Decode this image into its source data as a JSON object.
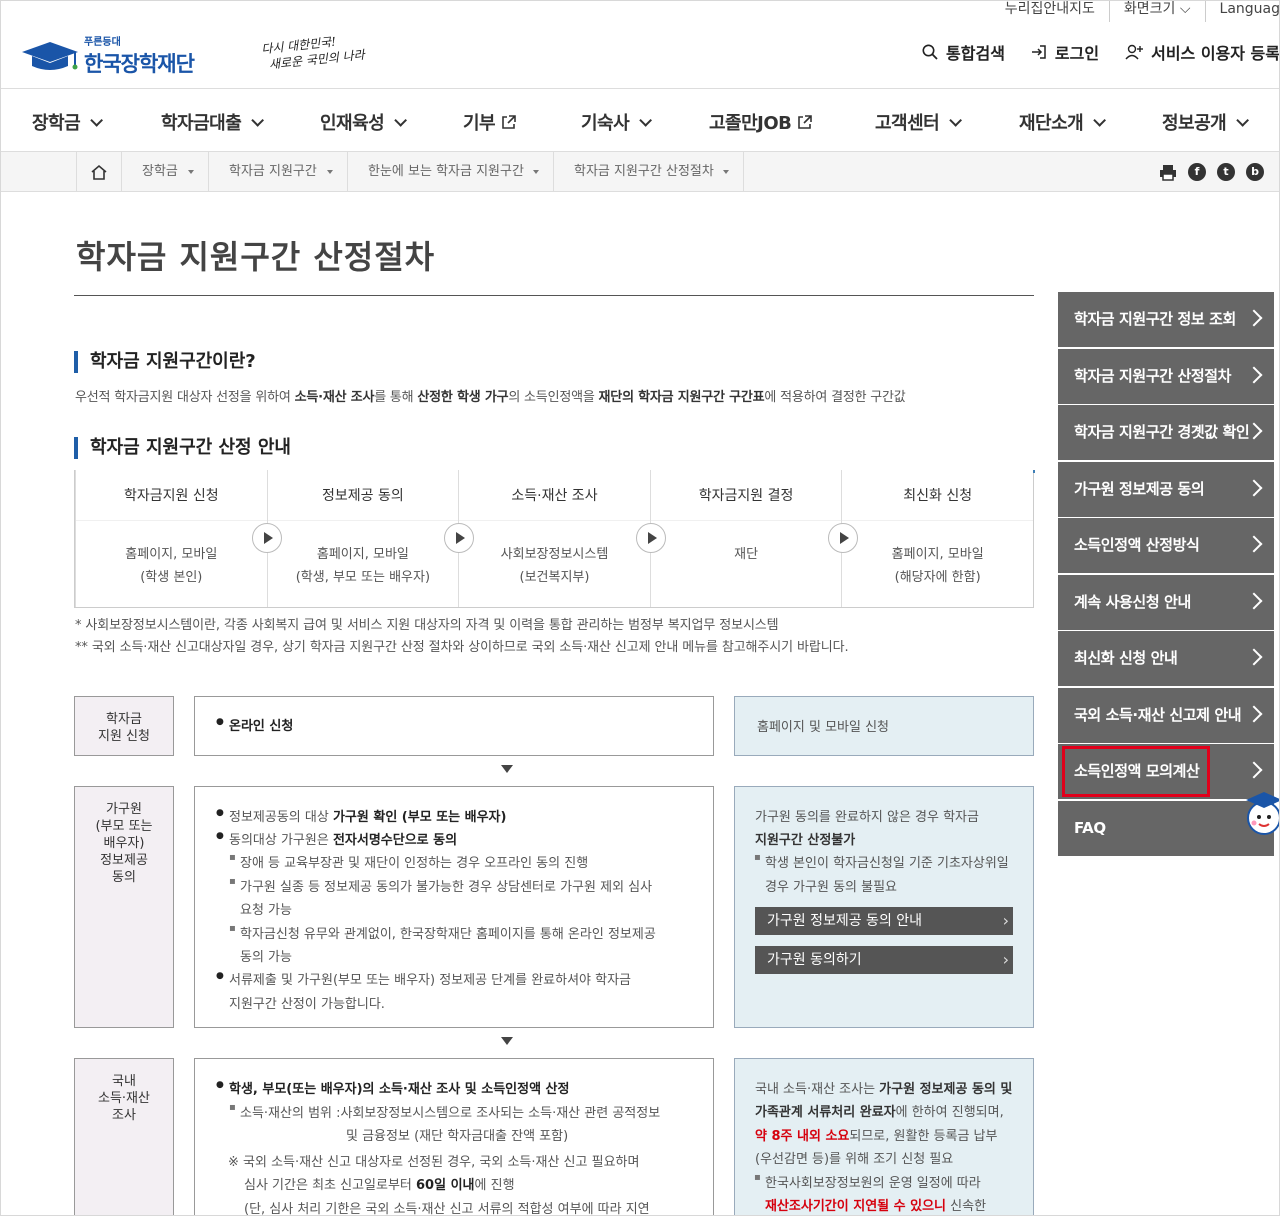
{
  "util": {
    "map": "누리집안내지도",
    "zoom": "화면크기",
    "lang": "Languag"
  },
  "logo": {
    "small": "푸른등대",
    "name": "한국장학재단"
  },
  "slogan": {
    "line1": "다시 대한민국!",
    "line2": "새로운 국민의 나라"
  },
  "header": {
    "search": "통합검색",
    "login": "로그인",
    "register": "서비스 이용자 등록"
  },
  "gnb": [
    "장학금",
    "학자금대출",
    "인재육성",
    "기부",
    "기숙사",
    "고졸만JOB",
    "고객센터",
    "재단소개",
    "정보공개"
  ],
  "breadcrumb": [
    "장학금",
    "학자금 지원구간",
    "한눈에 보는 학자금 지원구간",
    "학자금 지원구간 산정절차"
  ],
  "share": {
    "fb": "f",
    "tw": "t",
    "blog": "b"
  },
  "page_title": "학자금 지원구간 산정절차",
  "sec1": {
    "title": "학자금 지원구간이란?",
    "desc_parts": [
      "우선적 학자금지원 대상자 선정을 위하여 ",
      "소득·재산 조사",
      "를 통해 ",
      "산정한 학생 가구",
      "의 소득인정액을 ",
      "재단의 학자금 지원구간 구간표",
      "에 적용하여 결정한 구간값"
    ]
  },
  "sec2": {
    "title": "학자금 지원구간 산정 안내"
  },
  "steps": [
    {
      "title": "학자금지원 신청",
      "l1": "홈페이지, 모바일",
      "l2": "(학생 본인)"
    },
    {
      "title": "정보제공 동의",
      "l1": "홈페이지, 모바일",
      "l2": "(학생, 부모 또는 배우자)"
    },
    {
      "title": "소득·재산 조사",
      "l1": "사회보장정보시스템",
      "l2": "(보건복지부)"
    },
    {
      "title": "학자금지원 결정",
      "l1": "재단",
      "l2": ""
    },
    {
      "title": "최신화 신청",
      "l1": "홈페이지, 모바일",
      "l2": "(해당자에 한함)"
    }
  ],
  "notes": {
    "n1": "* 사회보장정보시스템이란, 각종 사회복지 급여 및 서비스 지원 대상자의 자격 및 이력을 통합 관리하는 범정부 복지업무 정보시스템",
    "n2": "** 국외 소득·재산 신고대상자일 경우, 상기 학자금 지원구간 산정 절차와 상이하므로 국외 소득·재산 신고제 안내 메뉴를 참고해주시기 바랍니다."
  },
  "row1": {
    "l1": "학자금",
    "l2": "지원 신청",
    "main": "온라인 신청",
    "right": "홈페이지 및 모바일 신청"
  },
  "row2": {
    "label": [
      "가구원",
      "(부모 또는",
      "배우자)",
      "정보제공",
      "동의"
    ],
    "a1": "정보제공동의 대상 ",
    "a1b": "가구원 확인 (부모 또는 배우자)",
    "a2": "동의대상 가구원은 ",
    "a2b": "전자서명수단으로 동의",
    "s1": "장애 등 교육부장관 및 재단이 인정하는 경우 오프라인 동의 진행",
    "s2a": "가구원 실종 등 정보제공 동의가 불가능한 경우 상담센터로 가구원 제외 심사",
    "s2b": "요청 가능",
    "s3a": "학자금신청 유무와 관계없이, 한국장학재단 홈페이지를 통해 온라인 정보제공",
    "s3b": "동의 가능",
    "a3a": "서류제출 및 가구원(부모 또는 배우자) 정보제공 단계를 완료하셔야 학자금",
    "a3b": "지원구간 산정이 가능합니다.",
    "r1": "가구원 동의를 완료하지 않은 경우 학자금",
    "r2": "지원구간 산정불가",
    "r3": "학생 본인이 학자금신청일 기준 기초자상위일",
    "r4": "경우 가구원 동의 불필요",
    "btn1": "가구원 정보제공 동의 안내",
    "btn2": "가구원 동의하기"
  },
  "row3": {
    "label": [
      "국내",
      "소득·재산",
      "조사"
    ],
    "a1": "학생, 부모(또는 배우자)의 소득·재산 조사 및 소득인정액 산정",
    "s1a": "소득·재산의 범위 :사회보장정보시스템으로 조사되는 소득·재산 관련 공적정보",
    "s1b": "및 금융정보 (재단 학자금대출 잔액 포함)",
    "s2a": "※ 국외 소득·재산 신고 대상자로 선정된 경우, 국외 소득·재산 신고 필요하며",
    "s2b1": "심사 기간은 최초 신고일로부터 ",
    "s2bb": "60일 이내",
    "s2b2": "에 진행",
    "s2c": "(단, 심사 처리 기한은 국외 소득·재산 신고 서류의 적합성 여부에 따라 지연",
    "r1a": "국내 소득·재산 조사는 ",
    "r1b": "가구원 정보제공 동의 및",
    "r2a": "가족관계 서류처리 완료자",
    "r2b": "에 한하여 진행되며,",
    "r3a": "약 8주 내외 소요",
    "r3b": "되므로, 원활한 등록금 납부",
    "r4": "(우선감면 등)를 위해 조기 신청 필요",
    "r5": "한국사회보장정보원의 운영 일정에 따라",
    "r6a": "재산조사기간이 지연될 수 있으니",
    "r6b": " 신속한"
  },
  "side_menu": [
    "학자금 지원구간 정보 조회",
    "학자금 지원구간 산정절차",
    "학자금 지원구간 경곗값 확인",
    "가구원 정보제공 동의",
    "소득인정액 산정방식",
    "계속 사용신청 안내",
    "최신화 신청 안내",
    "국외 소득·재산 신고제 안내",
    "소득인정액 모의계산",
    "FAQ"
  ]
}
